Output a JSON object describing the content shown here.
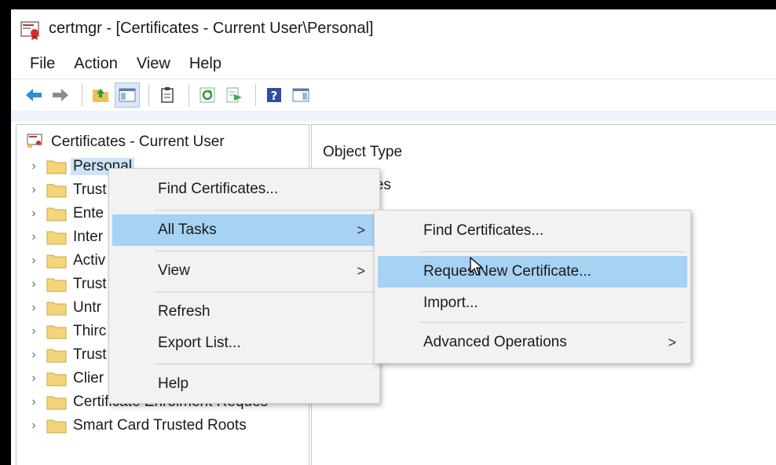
{
  "window": {
    "title": "certmgr - [Certificates - Current User\\Personal]"
  },
  "menubar": {
    "items": [
      "File",
      "Action",
      "View",
      "Help"
    ]
  },
  "toolbar": {
    "buttons": [
      "back-arrow-icon",
      "forward-arrow-icon",
      "up-folder-icon",
      "show-hide-tree-icon",
      "clipboard-icon",
      "refresh-icon",
      "export-list-icon",
      "help-icon",
      "properties-pane-icon"
    ]
  },
  "tree": {
    "root": "Certificates - Current User",
    "items": [
      "Personal",
      "Trust",
      "Ente",
      "Inter",
      "Activ",
      "Trust",
      "Untr",
      "Thirc",
      "Trust",
      "Clier",
      "Certificate Enrolment Reques",
      "Smart Card Trusted Roots"
    ],
    "selected_index": 0
  },
  "detail": {
    "column_header": "Object Type",
    "items": [
      "ficates"
    ]
  },
  "context_menu": {
    "items": [
      {
        "label": "Find Certificates...",
        "submenu": false
      },
      {
        "label": "All Tasks",
        "submenu": true
      },
      {
        "label": "View",
        "submenu": true
      },
      {
        "label": "Refresh",
        "submenu": false
      },
      {
        "label": "Export List...",
        "submenu": false
      },
      {
        "label": "Help",
        "submenu": false
      }
    ],
    "arrow": ">"
  },
  "submenu": {
    "items": [
      {
        "label": "Find Certificates...",
        "submenu": false
      },
      {
        "label": "Reques New Certificate...",
        "submenu": false
      },
      {
        "label": "Import...",
        "submenu": false
      },
      {
        "label": "Advanced Operations",
        "submenu": true
      }
    ],
    "arrow": ">"
  },
  "colors": {
    "hover": "#a6d2f4",
    "selection": "#cce4f7",
    "folder": "#f4d57a"
  }
}
